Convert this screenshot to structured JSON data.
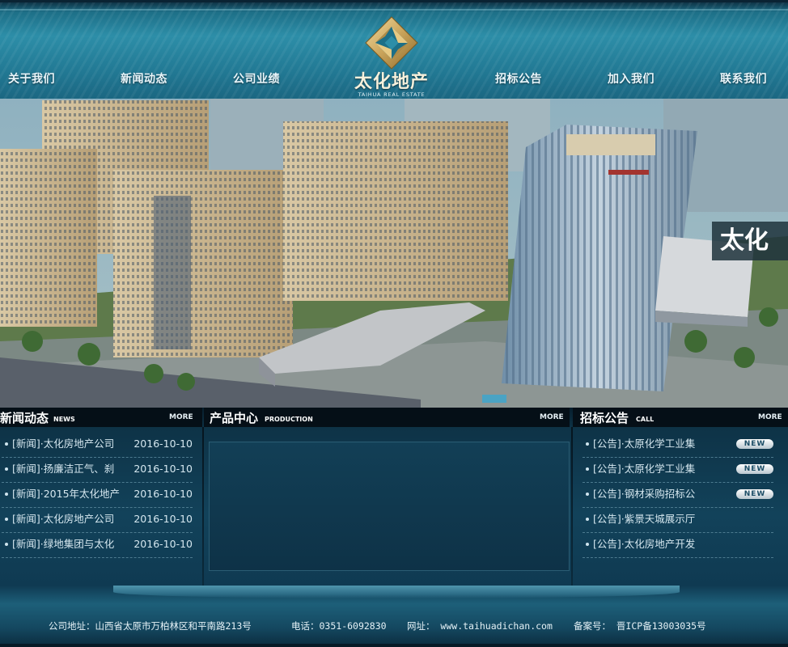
{
  "nav": {
    "left": [
      "关于我们",
      "新闻动态",
      "公司业绩"
    ],
    "right": [
      "招标公告",
      "加入我们",
      "联系我们"
    ]
  },
  "logo": {
    "name_cn": "太化地产",
    "name_en": "TAIHUA REAL ESTATE",
    "color_gold": "#c9a35a"
  },
  "banner": {
    "overlay_text": "太化"
  },
  "news": {
    "title": "新闻动态",
    "subtitle": "NEWS",
    "more": "MORE",
    "items": [
      {
        "text": "[新闻]·太化房地产公司",
        "date": "2016-10-10"
      },
      {
        "text": "[新闻]·扬廉洁正气、刹",
        "date": "2016-10-10"
      },
      {
        "text": "[新闻]·2015年太化地产",
        "date": "2016-10-10"
      },
      {
        "text": "[新闻]·太化房地产公司",
        "date": "2016-10-10"
      },
      {
        "text": "[新闻]·绿地集团与太化",
        "date": "2016-10-10"
      }
    ]
  },
  "production": {
    "title": "产品中心",
    "subtitle": "PRODUCTION",
    "more": "MORE"
  },
  "bids": {
    "title": "招标公告",
    "subtitle": "CALL",
    "more": "MORE",
    "new_badge": "NEW",
    "items": [
      {
        "text": "[公告]·太原化学工业集",
        "is_new": true
      },
      {
        "text": "[公告]·太原化学工业集",
        "is_new": true
      },
      {
        "text": "[公告]·钢材采购招标公",
        "is_new": true
      },
      {
        "text": "[公告]·紫景天城展示厅",
        "is_new": false
      },
      {
        "text": "[公告]·太化房地产开发",
        "is_new": false
      }
    ]
  },
  "footer": {
    "address": "公司地址：山西省太原市万柏林区和平南路213号",
    "phone": "电话：0351-6092830",
    "website": "网址： www.taihuadichan.com",
    "icp": "备案号： 晋ICP备13003035号"
  }
}
